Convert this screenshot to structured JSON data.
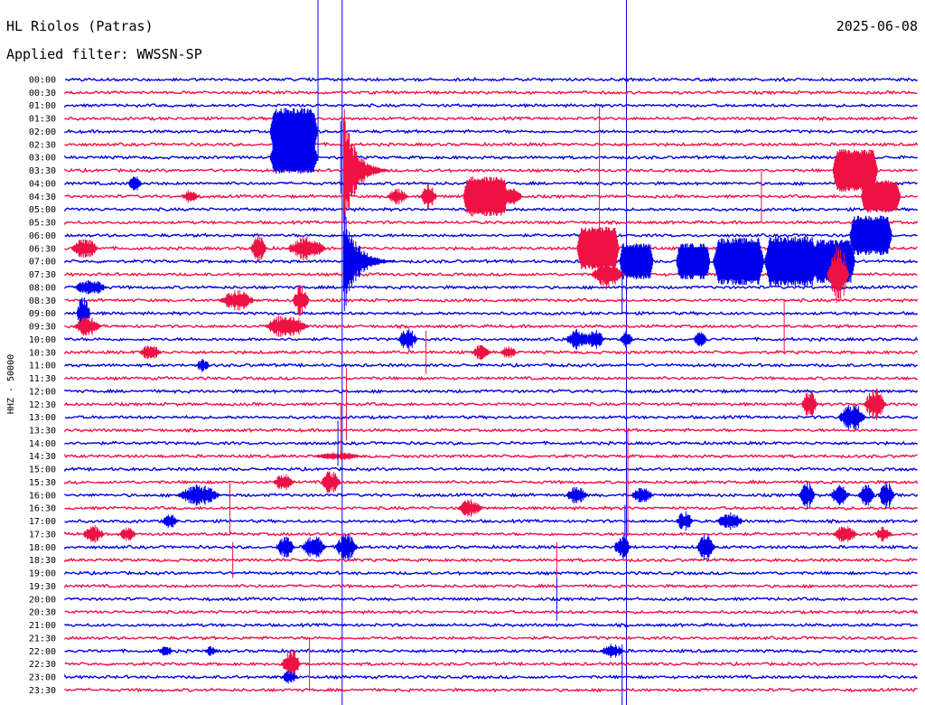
{
  "header": {
    "station": "HL Riolos (Patras)",
    "filter": "Applied filter: WWSSN-SP",
    "date": "2025-06-08"
  },
  "chart_data": {
    "type": "line",
    "ylabel": "HHZ - 50000",
    "rows": [
      "00:00",
      "00:30",
      "01:00",
      "01:30",
      "02:00",
      "02:30",
      "03:00",
      "03:30",
      "04:00",
      "04:30",
      "05:00",
      "05:30",
      "06:00",
      "06:30",
      "07:00",
      "07:30",
      "08:00",
      "08:30",
      "09:00",
      "09:30",
      "10:00",
      "10:30",
      "11:00",
      "11:30",
      "12:00",
      "12:30",
      "13:00",
      "13:30",
      "14:00",
      "14:30",
      "15:00",
      "15:30",
      "16:00",
      "16:30",
      "17:00",
      "17:30",
      "18:00",
      "18:30",
      "19:00",
      "19:30",
      "20:00",
      "20:30",
      "21:00",
      "21:30",
      "22:00",
      "22:30",
      "23:00",
      "23:30"
    ],
    "row_colors": [
      "#0000ee",
      "#ee1144"
    ],
    "trace_span_minutes": 30,
    "events": [
      {
        "row": 4,
        "minute": 7.2,
        "amp": 26,
        "dur": 1.7,
        "mode": "block"
      },
      {
        "row": 6,
        "minute": 7.2,
        "amp": 18,
        "dur": 1.7,
        "mode": "block"
      },
      {
        "row": 9,
        "minute": 14.0,
        "amp": 22,
        "dur": 1.6,
        "mode": "block"
      },
      {
        "row": 7,
        "minute": 27.0,
        "amp": 24,
        "dur": 1.6,
        "mode": "block"
      },
      {
        "row": 9,
        "minute": 28.0,
        "amp": 18,
        "dur": 1.4,
        "mode": "block"
      },
      {
        "row": 12,
        "minute": 27.6,
        "amp": 22,
        "dur": 1.5,
        "mode": "block"
      },
      {
        "row": 13,
        "minute": 18.0,
        "amp": 24,
        "dur": 1.5,
        "mode": "block"
      },
      {
        "row": 14,
        "minute": 19.5,
        "amp": 20,
        "dur": 1.2,
        "mode": "block"
      },
      {
        "row": 14,
        "minute": 21.5,
        "amp": 20,
        "dur": 1.2,
        "mode": "block"
      },
      {
        "row": 14,
        "minute": 22.8,
        "amp": 26,
        "dur": 1.8,
        "mode": "block"
      },
      {
        "row": 14,
        "minute": 24.6,
        "amp": 28,
        "dur": 1.9,
        "mode": "block"
      },
      {
        "row": 14,
        "minute": 26.3,
        "amp": 24,
        "dur": 1.5,
        "mode": "block"
      },
      {
        "row": 7,
        "minute": 9.8,
        "amp": 75,
        "dur": 1.6,
        "mode": "decay"
      },
      {
        "row": 14,
        "minute": 9.8,
        "amp": 60,
        "dur": 1.8,
        "mode": "decay"
      },
      {
        "row": 9,
        "minute": 4.1,
        "amp": 8,
        "dur": 0.6,
        "mode": "burst"
      },
      {
        "row": 8,
        "minute": 2.2,
        "amp": 10,
        "dur": 0.5,
        "mode": "burst"
      },
      {
        "row": 9,
        "minute": 11.3,
        "amp": 9,
        "dur": 0.8,
        "mode": "burst"
      },
      {
        "row": 9,
        "minute": 12.5,
        "amp": 14,
        "dur": 0.6,
        "mode": "burst"
      },
      {
        "row": 9,
        "minute": 15.4,
        "amp": 11,
        "dur": 0.7,
        "mode": "burst"
      },
      {
        "row": 12,
        "minute": 27.6,
        "amp": 10,
        "dur": 0.6,
        "mode": "burst"
      },
      {
        "row": 13,
        "minute": 0.2,
        "amp": 12,
        "dur": 1.0,
        "mode": "burst"
      },
      {
        "row": 13,
        "minute": 6.5,
        "amp": 16,
        "dur": 0.6,
        "mode": "burst"
      },
      {
        "row": 13,
        "minute": 7.8,
        "amp": 14,
        "dur": 1.4,
        "mode": "burst"
      },
      {
        "row": 15,
        "minute": 18.5,
        "amp": 18,
        "dur": 1.2,
        "mode": "burst"
      },
      {
        "row": 15,
        "minute": 26.8,
        "amp": 34,
        "dur": 0.8,
        "mode": "burst"
      },
      {
        "row": 16,
        "minute": 0.3,
        "amp": 10,
        "dur": 1.2,
        "mode": "burst"
      },
      {
        "row": 17,
        "minute": 5.4,
        "amp": 12,
        "dur": 1.3,
        "mode": "burst"
      },
      {
        "row": 17,
        "minute": 8.0,
        "amp": 18,
        "dur": 0.6,
        "mode": "burst"
      },
      {
        "row": 18,
        "minute": 0.4,
        "amp": 22,
        "dur": 0.5,
        "mode": "burst"
      },
      {
        "row": 19,
        "minute": 0.3,
        "amp": 12,
        "dur": 1.0,
        "mode": "burst"
      },
      {
        "row": 19,
        "minute": 7.0,
        "amp": 14,
        "dur": 1.6,
        "mode": "burst"
      },
      {
        "row": 20,
        "minute": 11.7,
        "amp": 14,
        "dur": 0.7,
        "mode": "burst"
      },
      {
        "row": 20,
        "minute": 17.6,
        "amp": 12,
        "dur": 0.9,
        "mode": "burst"
      },
      {
        "row": 20,
        "minute": 18.3,
        "amp": 12,
        "dur": 0.7,
        "mode": "burst"
      },
      {
        "row": 20,
        "minute": 19.5,
        "amp": 10,
        "dur": 0.5,
        "mode": "burst"
      },
      {
        "row": 20,
        "minute": 22.1,
        "amp": 9,
        "dur": 0.5,
        "mode": "burst"
      },
      {
        "row": 21,
        "minute": 2.6,
        "amp": 9,
        "dur": 0.8,
        "mode": "burst"
      },
      {
        "row": 21,
        "minute": 14.3,
        "amp": 9,
        "dur": 0.7,
        "mode": "burst"
      },
      {
        "row": 21,
        "minute": 15.3,
        "amp": 8,
        "dur": 0.6,
        "mode": "burst"
      },
      {
        "row": 22,
        "minute": 4.6,
        "amp": 8,
        "dur": 0.5,
        "mode": "burst"
      },
      {
        "row": 25,
        "minute": 25.9,
        "amp": 16,
        "dur": 0.6,
        "mode": "burst"
      },
      {
        "row": 25,
        "minute": 28.1,
        "amp": 18,
        "dur": 0.8,
        "mode": "burst"
      },
      {
        "row": 26,
        "minute": 27.2,
        "amp": 16,
        "dur": 1.0,
        "mode": "burst"
      },
      {
        "row": 29,
        "minute": 8.7,
        "amp": 5,
        "dur": 1.8,
        "mode": "burst"
      },
      {
        "row": 31,
        "minute": 7.3,
        "amp": 10,
        "dur": 0.8,
        "mode": "burst"
      },
      {
        "row": 31,
        "minute": 9.0,
        "amp": 14,
        "dur": 0.7,
        "mode": "burst"
      },
      {
        "row": 32,
        "minute": 3.9,
        "amp": 12,
        "dur": 1.6,
        "mode": "burst"
      },
      {
        "row": 32,
        "minute": 17.6,
        "amp": 10,
        "dur": 0.8,
        "mode": "burst"
      },
      {
        "row": 32,
        "minute": 19.9,
        "amp": 10,
        "dur": 0.8,
        "mode": "burst"
      },
      {
        "row": 32,
        "minute": 25.8,
        "amp": 16,
        "dur": 0.6,
        "mode": "burst"
      },
      {
        "row": 32,
        "minute": 26.9,
        "amp": 12,
        "dur": 0.7,
        "mode": "burst"
      },
      {
        "row": 32,
        "minute": 27.9,
        "amp": 14,
        "dur": 0.6,
        "mode": "burst"
      },
      {
        "row": 32,
        "minute": 28.6,
        "amp": 16,
        "dur": 0.6,
        "mode": "burst"
      },
      {
        "row": 33,
        "minute": 13.8,
        "amp": 10,
        "dur": 0.9,
        "mode": "burst"
      },
      {
        "row": 34,
        "minute": 3.4,
        "amp": 8,
        "dur": 0.6,
        "mode": "burst"
      },
      {
        "row": 34,
        "minute": 21.5,
        "amp": 12,
        "dur": 0.6,
        "mode": "burst"
      },
      {
        "row": 34,
        "minute": 22.9,
        "amp": 10,
        "dur": 1.0,
        "mode": "burst"
      },
      {
        "row": 35,
        "minute": 0.6,
        "amp": 10,
        "dur": 0.8,
        "mode": "burst"
      },
      {
        "row": 35,
        "minute": 1.9,
        "amp": 9,
        "dur": 0.6,
        "mode": "burst"
      },
      {
        "row": 35,
        "minute": 27.0,
        "amp": 10,
        "dur": 0.9,
        "mode": "burst"
      },
      {
        "row": 35,
        "minute": 28.5,
        "amp": 9,
        "dur": 0.6,
        "mode": "burst"
      },
      {
        "row": 36,
        "minute": 7.4,
        "amp": 12,
        "dur": 0.7,
        "mode": "burst"
      },
      {
        "row": 36,
        "minute": 8.3,
        "amp": 14,
        "dur": 0.9,
        "mode": "burst"
      },
      {
        "row": 36,
        "minute": 9.5,
        "amp": 16,
        "dur": 0.8,
        "mode": "burst"
      },
      {
        "row": 36,
        "minute": 19.3,
        "amp": 14,
        "dur": 0.6,
        "mode": "burst"
      },
      {
        "row": 36,
        "minute": 22.2,
        "amp": 16,
        "dur": 0.7,
        "mode": "burst"
      },
      {
        "row": 44,
        "minute": 3.3,
        "amp": 7,
        "dur": 0.5,
        "mode": "burst"
      },
      {
        "row": 44,
        "minute": 4.9,
        "amp": 6,
        "dur": 0.5,
        "mode": "burst"
      },
      {
        "row": 44,
        "minute": 18.8,
        "amp": 8,
        "dur": 0.9,
        "mode": "burst"
      },
      {
        "row": 45,
        "minute": 7.6,
        "amp": 18,
        "dur": 0.7,
        "mode": "burst"
      },
      {
        "row": 46,
        "minute": 7.6,
        "amp": 8,
        "dur": 0.6,
        "mode": "burst"
      }
    ],
    "spikes": [
      {
        "row": 0,
        "minute": 8.9,
        "amp": 90
      },
      {
        "row": 6,
        "minute": 9.7,
        "amp": 40
      },
      {
        "row": 9,
        "minute": 24.5,
        "amp": 28
      },
      {
        "row": 16,
        "minute": 19.6,
        "amp": 30
      },
      {
        "row": 19,
        "minute": 25.3,
        "amp": 30
      },
      {
        "row": 21,
        "minute": 12.7,
        "amp": 24
      },
      {
        "row": 25,
        "minute": 9.9,
        "amp": 40
      },
      {
        "row": 27,
        "minute": 9.7,
        "amp": 30
      },
      {
        "row": 28,
        "minute": 9.6,
        "amp": 25
      },
      {
        "row": 31,
        "minute": 19.8,
        "amp": 60
      },
      {
        "row": 33,
        "minute": 5.8,
        "amp": 28
      },
      {
        "row": 34,
        "minute": 19.7,
        "amp": 18
      },
      {
        "row": 37,
        "minute": 5.9,
        "amp": 20
      },
      {
        "row": 37,
        "minute": 17.3,
        "amp": 20
      },
      {
        "row": 40,
        "minute": 17.3,
        "amp": 24
      },
      {
        "row": 45,
        "minute": 8.6,
        "amp": 30
      },
      {
        "row": 46,
        "minute": 19.6,
        "amp": 36
      },
      {
        "row": 7,
        "minute": 18.8,
        "amp": 70
      }
    ],
    "gridlines": [
      {
        "minute": 9.75
      },
      {
        "minute": 19.75
      }
    ]
  }
}
